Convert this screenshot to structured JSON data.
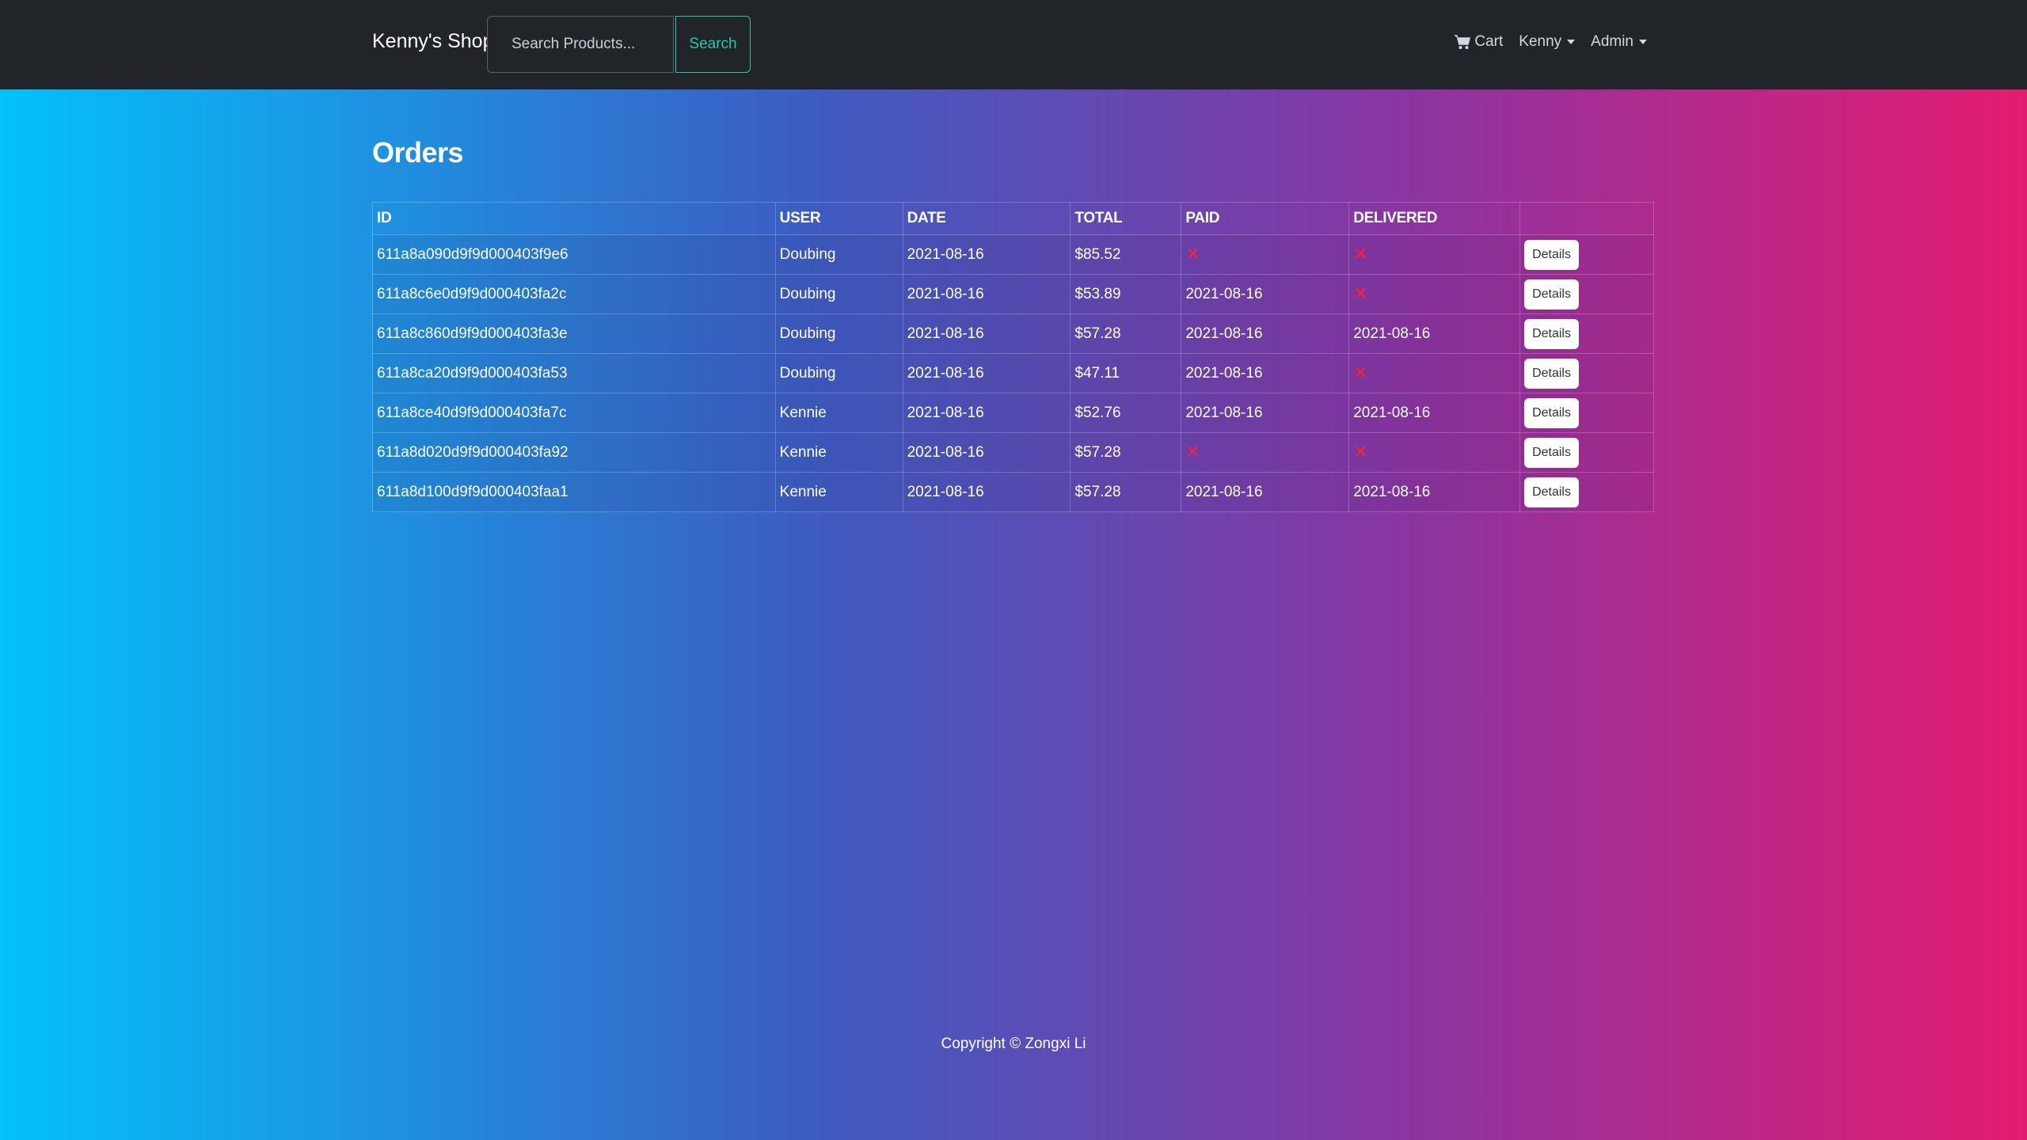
{
  "navbar": {
    "brand": "Kenny's Shop",
    "search_placeholder": "Search Products...",
    "search_button": "Search",
    "cart_label": "Cart",
    "user_menu": "Kenny",
    "admin_menu": "Admin"
  },
  "main": {
    "title": "Orders",
    "table": {
      "headers": [
        "ID",
        "USER",
        "DATE",
        "TOTAL",
        "PAID",
        "DELIVERED",
        ""
      ],
      "rows": [
        {
          "id": "611a8a090d9f9d000403f9e6",
          "user": "Doubing",
          "date": "2021-08-16",
          "total": "$85.52",
          "paid": null,
          "delivered": null,
          "action": "Details"
        },
        {
          "id": "611a8c6e0d9f9d000403fa2c",
          "user": "Doubing",
          "date": "2021-08-16",
          "total": "$53.89",
          "paid": "2021-08-16",
          "delivered": null,
          "action": "Details"
        },
        {
          "id": "611a8c860d9f9d000403fa3e",
          "user": "Doubing",
          "date": "2021-08-16",
          "total": "$57.28",
          "paid": "2021-08-16",
          "delivered": "2021-08-16",
          "action": "Details"
        },
        {
          "id": "611a8ca20d9f9d000403fa53",
          "user": "Doubing",
          "date": "2021-08-16",
          "total": "$47.11",
          "paid": "2021-08-16",
          "delivered": null,
          "action": "Details"
        },
        {
          "id": "611a8ce40d9f9d000403fa7c",
          "user": "Kennie",
          "date": "2021-08-16",
          "total": "$52.76",
          "paid": "2021-08-16",
          "delivered": "2021-08-16",
          "action": "Details"
        },
        {
          "id": "611a8d020d9f9d000403fa92",
          "user": "Kennie",
          "date": "2021-08-16",
          "total": "$57.28",
          "paid": null,
          "delivered": null,
          "action": "Details"
        },
        {
          "id": "611a8d100d9f9d000403faa1",
          "user": "Kennie",
          "date": "2021-08-16",
          "total": "$57.28",
          "paid": "2021-08-16",
          "delivered": "2021-08-16",
          "action": "Details"
        }
      ],
      "not_done_icon": "x-icon",
      "not_done_color": "#ff1f3a"
    }
  },
  "footer": {
    "copyright": "Copyright © Zongxi Li"
  },
  "colors": {
    "navbar_bg": "#212428",
    "search_accent": "#2ec4a4",
    "gradient_start": "#03c1fa",
    "gradient_end": "#e51c71"
  }
}
